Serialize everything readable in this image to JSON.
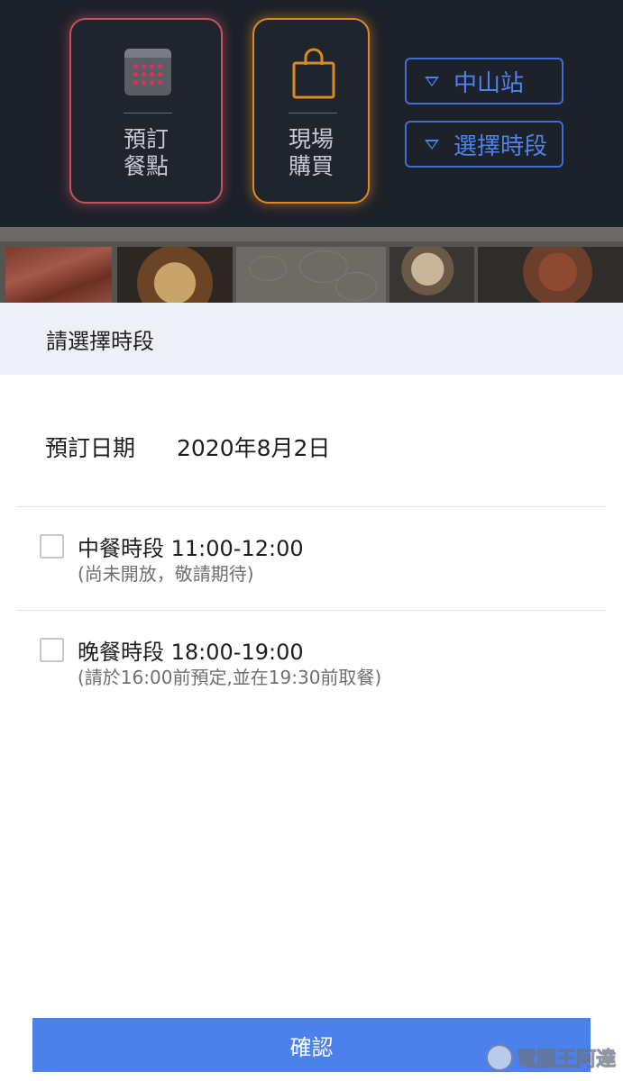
{
  "header": {
    "order_tile": {
      "line1": "預訂",
      "line2": "餐點",
      "icon": "calendar-icon",
      "accent": "#c2535f"
    },
    "onsite_tile": {
      "line1": "現場",
      "line2": "購買",
      "icon": "shopping-bag-icon",
      "accent": "#d98a26"
    },
    "station_filter": {
      "label": "中山站",
      "icon": "triangle-down-icon"
    },
    "timeslot_filter": {
      "label": "選擇時段",
      "icon": "triangle-down-icon"
    },
    "filter_color": "#4f82ee"
  },
  "sheet": {
    "title": "請選擇時段",
    "date_label": "預訂日期",
    "date_value": "2020年8月2日",
    "slots": [
      {
        "title": "中餐時段 11:00-12:00",
        "note": "(尚未開放，敬請期待)",
        "checked": false
      },
      {
        "title": "晚餐時段 18:00-19:00",
        "note": "(請於16:00前預定,並在19:30前取餐)",
        "checked": false
      }
    ],
    "confirm_label": "確認",
    "confirm_color": "#4c80ea"
  },
  "watermark": {
    "text": "電腦王阿達"
  }
}
